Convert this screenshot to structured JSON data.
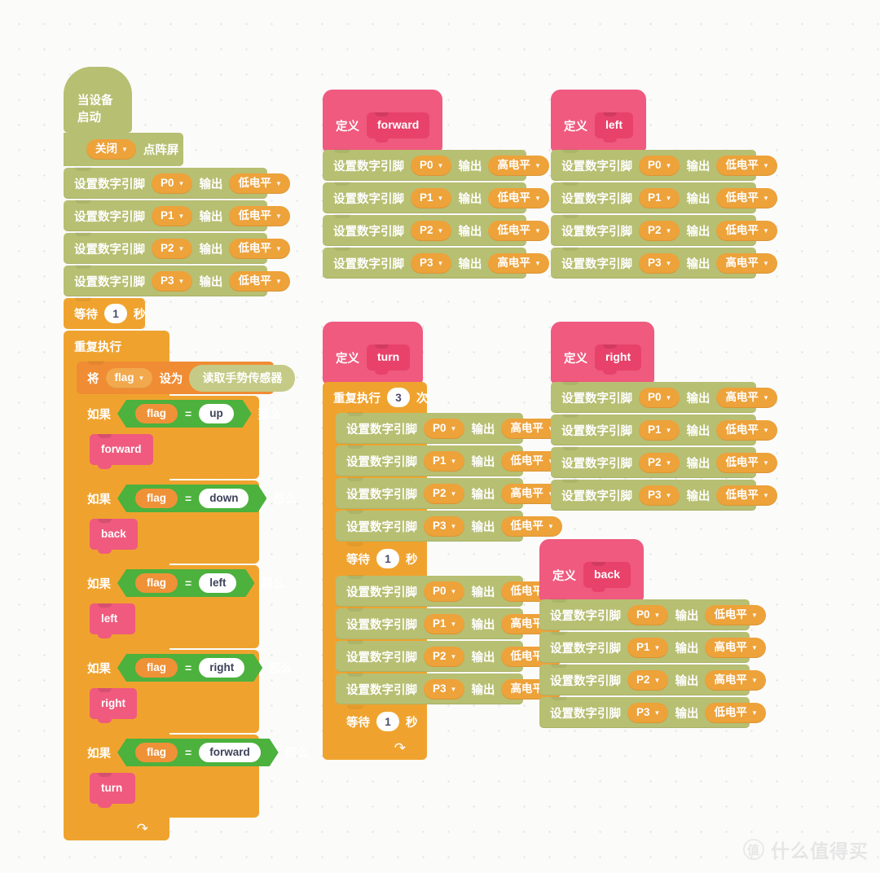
{
  "canvas": {
    "background": "#fbfbfa",
    "grid_dot_color": "#e2e2e0"
  },
  "palette": {
    "pin_block": "#b7bf72",
    "control_block": "#efa32e",
    "variable_block": "#f08c33",
    "function_block": "#ef5a7e",
    "boolean_block": "#4cb13d",
    "field_orange": "#eda23a",
    "field_white": "#ffffff"
  },
  "labels": {
    "on_start": "当设备启动",
    "set_digital_pin": "设置数字引脚",
    "output": "输出",
    "high": "高电平",
    "low": "低电平",
    "off": "关闭",
    "led_matrix": "点阵屏",
    "wait": "等待",
    "seconds": "秒",
    "forever": "重复执行",
    "repeat": "重复执行",
    "times": "次",
    "set": "将",
    "to": "设为",
    "if": "如果",
    "then": "那么",
    "define": "定义",
    "gesture_sensor": "读取手势传感器",
    "equals": "=",
    "caret": "▾",
    "loop_arrow": "↻"
  },
  "main_script": {
    "hat": "当设备启动",
    "led_off": {
      "state": "关闭",
      "target": "点阵屏"
    },
    "init_pins": [
      {
        "pin": "P0",
        "level": "低电平"
      },
      {
        "pin": "P1",
        "level": "低电平"
      },
      {
        "pin": "P2",
        "level": "低电平"
      },
      {
        "pin": "P3",
        "level": "低电平"
      }
    ],
    "wait": {
      "value": "1",
      "unit": "秒"
    },
    "forever_label": "重复执行",
    "set_variable": {
      "variable": "flag",
      "value_reporter": "读取手势传感器"
    },
    "conditions": [
      {
        "variable": "flag",
        "operator": "=",
        "value": "up",
        "call": "forward"
      },
      {
        "variable": "flag",
        "operator": "=",
        "value": "down",
        "call": "back"
      },
      {
        "variable": "flag",
        "operator": "=",
        "value": "left",
        "call": "left"
      },
      {
        "variable": "flag",
        "operator": "=",
        "value": "right",
        "call": "right"
      },
      {
        "variable": "flag",
        "operator": "=",
        "value": "forward",
        "call": "turn"
      }
    ]
  },
  "functions": [
    {
      "id": "forward",
      "name": "forward",
      "pins": [
        {
          "pin": "P0",
          "level": "高电平"
        },
        {
          "pin": "P1",
          "level": "低电平"
        },
        {
          "pin": "P2",
          "level": "低电平"
        },
        {
          "pin": "P3",
          "level": "高电平"
        }
      ]
    },
    {
      "id": "left",
      "name": "left",
      "pins": [
        {
          "pin": "P0",
          "level": "低电平"
        },
        {
          "pin": "P1",
          "level": "低电平"
        },
        {
          "pin": "P2",
          "level": "低电平"
        },
        {
          "pin": "P3",
          "level": "高电平"
        }
      ]
    },
    {
      "id": "right",
      "name": "right",
      "pins": [
        {
          "pin": "P0",
          "level": "高电平"
        },
        {
          "pin": "P1",
          "level": "低电平"
        },
        {
          "pin": "P2",
          "level": "低电平"
        },
        {
          "pin": "P3",
          "level": "低电平"
        }
      ]
    },
    {
      "id": "back",
      "name": "back",
      "pins": [
        {
          "pin": "P0",
          "level": "低电平"
        },
        {
          "pin": "P1",
          "level": "高电平"
        },
        {
          "pin": "P2",
          "level": "高电平"
        },
        {
          "pin": "P3",
          "level": "低电平"
        }
      ]
    }
  ],
  "turn_function": {
    "name": "turn",
    "repeat_count": "3",
    "repeat_label": "重复执行",
    "times_label": "次",
    "pins_a": [
      {
        "pin": "P0",
        "level": "高电平"
      },
      {
        "pin": "P1",
        "level": "低电平"
      },
      {
        "pin": "P2",
        "level": "高电平"
      },
      {
        "pin": "P3",
        "level": "低电平"
      }
    ],
    "wait_a": "1",
    "pins_b": [
      {
        "pin": "P0",
        "level": "低电平"
      },
      {
        "pin": "P1",
        "level": "高电平"
      },
      {
        "pin": "P2",
        "level": "低电平"
      },
      {
        "pin": "P3",
        "level": "高电平"
      }
    ],
    "wait_b": "1"
  },
  "watermark": {
    "mark": "值",
    "text": "什么值得买"
  }
}
